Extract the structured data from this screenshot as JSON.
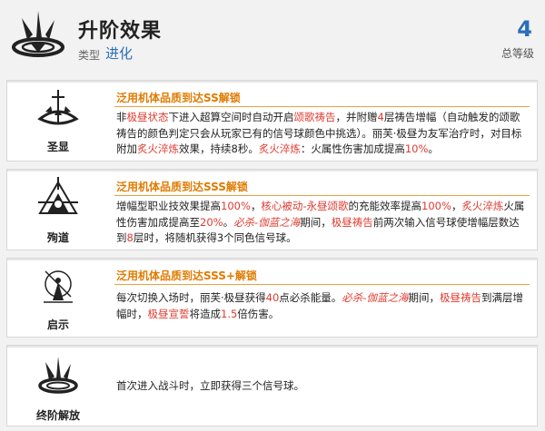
{
  "header": {
    "title": "升阶效果",
    "type_label": "类型",
    "type_value": "进化",
    "level_value": "4",
    "level_label": "总等级",
    "icon": "awakening-emblem-icon"
  },
  "cards": [
    {
      "name": "圣显",
      "icon": "sanctify-icon",
      "condition": "泛用机体品质到达SS解锁",
      "desc": [
        {
          "t": "非",
          "c": "n"
        },
        {
          "t": "极昼状态",
          "c": "r"
        },
        {
          "t": "下进入超算空间时自动开启",
          "c": "n"
        },
        {
          "t": "颂歌祷告",
          "c": "r"
        },
        {
          "t": "，并附赠",
          "c": "n"
        },
        {
          "t": "4",
          "c": "r"
        },
        {
          "t": "层祷告增幅（自动触发的颂歌祷告的颜色判定只会从玩家已有的信号球颜色中挑选）。丽芙·极昼为友军治疗时，对目标附加",
          "c": "n"
        },
        {
          "t": "炙火淬炼",
          "c": "r"
        },
        {
          "t": "效果，持续8秒。",
          "c": "n"
        },
        {
          "t": "炙火淬炼",
          "c": "r"
        },
        {
          "t": "：火属性伤害加成提高",
          "c": "n"
        },
        {
          "t": "10%",
          "c": "r"
        },
        {
          "t": "。",
          "c": "n"
        }
      ]
    },
    {
      "name": "殉道",
      "icon": "martyr-icon",
      "condition": "泛用机体品质到达SSS解锁",
      "desc": [
        {
          "t": "增幅型职业技效果提高",
          "c": "n"
        },
        {
          "t": "100%",
          "c": "r"
        },
        {
          "t": "，",
          "c": "n"
        },
        {
          "t": "核心被动-永昼颂歌",
          "c": "r"
        },
        {
          "t": "的充能效率提高",
          "c": "n"
        },
        {
          "t": "100%",
          "c": "r"
        },
        {
          "t": "，",
          "c": "n"
        },
        {
          "t": "炙火淬炼",
          "c": "r"
        },
        {
          "t": "火属性伤害加成提高至",
          "c": "n"
        },
        {
          "t": "20%",
          "c": "r"
        },
        {
          "t": "。",
          "c": "n"
        },
        {
          "t": "必杀-伽蓝之海",
          "c": "ri"
        },
        {
          "t": "期间，",
          "c": "n"
        },
        {
          "t": "极昼祷告",
          "c": "r"
        },
        {
          "t": "前两次输入信号球使增幅层数达到",
          "c": "n"
        },
        {
          "t": "8",
          "c": "r"
        },
        {
          "t": "层时，将随机获得3个同色信号球。",
          "c": "n"
        }
      ]
    },
    {
      "name": "启示",
      "icon": "revelation-icon",
      "condition": "泛用机体品质到达SSS+解锁",
      "desc": [
        {
          "t": "每次切换入场时，丽芙·极昼获得",
          "c": "n"
        },
        {
          "t": "40",
          "c": "r"
        },
        {
          "t": "点必杀能量。",
          "c": "n"
        },
        {
          "t": "必杀-伽蓝之海",
          "c": "ri"
        },
        {
          "t": "期间，",
          "c": "n"
        },
        {
          "t": "极昼祷告",
          "c": "r"
        },
        {
          "t": "到满层增幅时，",
          "c": "n"
        },
        {
          "t": "极昼宣誓",
          "c": "r"
        },
        {
          "t": "将造成",
          "c": "n"
        },
        {
          "t": "1.5",
          "c": "r"
        },
        {
          "t": "倍伤害。",
          "c": "n"
        }
      ]
    },
    {
      "name": "终阶解放",
      "icon": "final-release-icon",
      "condition": "",
      "desc": [
        {
          "t": "首次进入战斗时，立即获得三个信号球。",
          "c": "n"
        }
      ]
    }
  ]
}
